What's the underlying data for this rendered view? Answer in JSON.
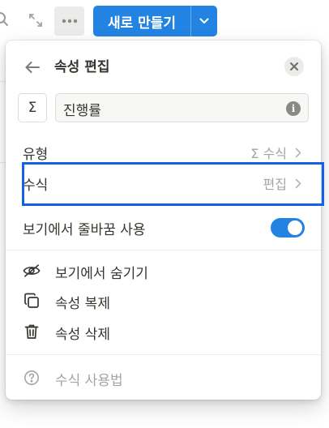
{
  "toolbar": {
    "search_icon": "search-icon",
    "expand_icon": "expand-icon",
    "more_icon": "more-horizontal-icon",
    "new_button_label": "새로 만들기",
    "accent": "#2383e2"
  },
  "panel": {
    "title": "속성 편집",
    "property_type_symbol": "Σ",
    "property_name": "진행률",
    "rows": {
      "type": {
        "label": "유형",
        "value": "Σ 수식"
      },
      "formula": {
        "label": "수식",
        "value": "편집"
      },
      "wrap": {
        "label": "보기에서 줄바꿈 사용",
        "enabled": true
      }
    },
    "actions": [
      {
        "label": "보기에서 숨기기",
        "icon": "eye-off-icon"
      },
      {
        "label": "속성 복제",
        "icon": "duplicate-icon"
      },
      {
        "label": "속성 삭제",
        "icon": "trash-icon"
      }
    ],
    "help": {
      "label": "수식 사용법",
      "icon": "help-circle-icon"
    }
  },
  "colors": {
    "highlight_border": "#1560e8",
    "toggle_on": "#2383e2"
  }
}
